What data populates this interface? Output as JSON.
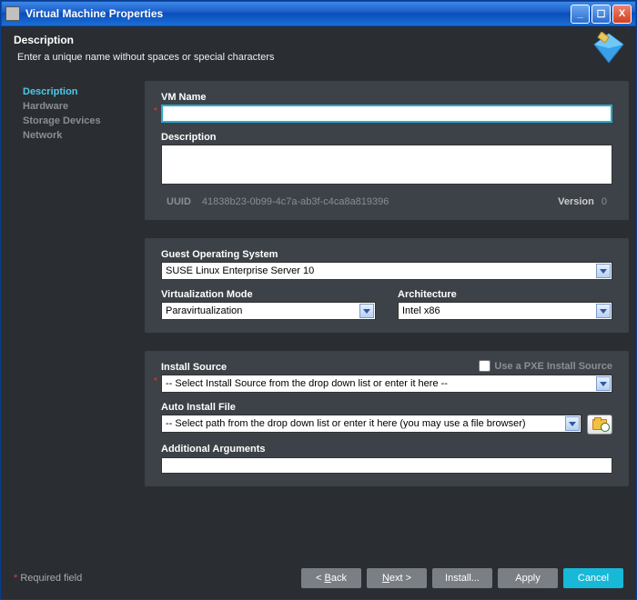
{
  "window": {
    "title": "Virtual Machine Properties"
  },
  "header": {
    "title": "Description",
    "subtitle": "Enter a unique name without spaces or special characters"
  },
  "sidebar": {
    "items": [
      {
        "label": "Description",
        "active": true
      },
      {
        "label": "Hardware",
        "active": false
      },
      {
        "label": "Storage Devices",
        "active": false
      },
      {
        "label": "Network",
        "active": false
      }
    ]
  },
  "panel1": {
    "vm_name_label": "VM Name",
    "vm_name_value": "",
    "description_label": "Description",
    "description_value": "",
    "uuid_label": "UUID",
    "uuid_value": "41838b23-0b99-4c7a-ab3f-c4ca8a819396",
    "version_label": "Version",
    "version_value": "0"
  },
  "panel2": {
    "guest_os_label": "Guest Operating System",
    "guest_os_value": "SUSE Linux Enterprise Server 10",
    "virt_mode_label": "Virtualization Mode",
    "virt_mode_value": "Paravirtualization",
    "arch_label": "Architecture",
    "arch_value": "Intel x86"
  },
  "panel3": {
    "install_source_label": "Install Source",
    "install_source_value": "-- Select Install Source from the drop down list or enter it here --",
    "pxe_label": "Use a PXE Install Source",
    "auto_install_label": "Auto Install File",
    "auto_install_value": "-- Select path from the drop down list or enter it here (you may use a file browser)",
    "additional_args_label": "Additional Arguments",
    "additional_args_value": ""
  },
  "footer": {
    "required_label": "Required field",
    "back": "< Back",
    "next": "Next >",
    "install": "Install...",
    "apply": "Apply",
    "cancel": "Cancel"
  }
}
